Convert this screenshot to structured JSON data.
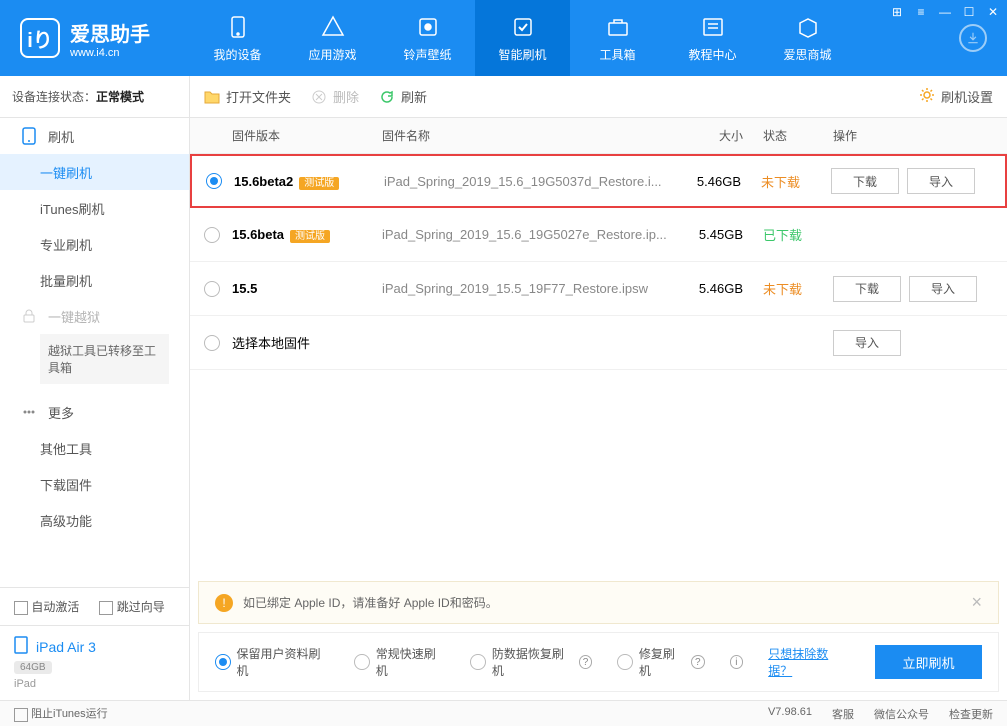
{
  "app": {
    "title": "爱思助手",
    "subtitle": "www.i4.cn"
  },
  "nav": {
    "tabs": [
      "我的设备",
      "应用游戏",
      "铃声壁纸",
      "智能刷机",
      "工具箱",
      "教程中心",
      "爱思商城"
    ],
    "active": 3
  },
  "deviceStatus": {
    "label": "设备连接状态：",
    "value": "正常模式"
  },
  "sidebar": {
    "flash_group": "刷机",
    "items": [
      "一键刷机",
      "iTunes刷机",
      "专业刷机",
      "批量刷机"
    ],
    "active": 0,
    "jailbreak": "一键越狱",
    "jailbreak_note": "越狱工具已转移至工具箱",
    "more_group": "更多",
    "more_items": [
      "其他工具",
      "下载固件",
      "高级功能"
    ]
  },
  "checks": {
    "auto_activate": "自动激活",
    "skip_guide": "跳过向导"
  },
  "device": {
    "name": "iPad Air 3",
    "storage": "64GB",
    "type": "iPad"
  },
  "toolbar": {
    "open_folder": "打开文件夹",
    "delete": "删除",
    "refresh": "刷新",
    "settings": "刷机设置"
  },
  "table": {
    "version": "固件版本",
    "name": "固件名称",
    "size": "大小",
    "status": "状态",
    "action": "操作"
  },
  "beta_badge": "测试版",
  "rows": [
    {
      "version": "15.6beta2",
      "beta": true,
      "name": "iPad_Spring_2019_15.6_19G5037d_Restore.i...",
      "size": "5.46GB",
      "status": "未下载",
      "status_cls": "notdl",
      "selected": true,
      "highlighted": true,
      "actions": true
    },
    {
      "version": "15.6beta",
      "beta": true,
      "name": "iPad_Spring_2019_15.6_19G5027e_Restore.ip...",
      "size": "5.45GB",
      "status": "已下载",
      "status_cls": "dl",
      "selected": false,
      "highlighted": false,
      "actions": false
    },
    {
      "version": "15.5",
      "beta": false,
      "name": "iPad_Spring_2019_15.5_19F77_Restore.ipsw",
      "size": "5.46GB",
      "status": "未下载",
      "status_cls": "notdl",
      "selected": false,
      "highlighted": false,
      "actions": true
    }
  ],
  "local_row": "选择本地固件",
  "actions": {
    "download": "下载",
    "import": "导入"
  },
  "notice": "如已绑定 Apple ID，请准备好 Apple ID和密码。",
  "options": {
    "opts": [
      "保留用户资料刷机",
      "常规快速刷机",
      "防数据恢复刷机",
      "修复刷机"
    ],
    "selected": 0,
    "erase_link": "只想抹除数据？",
    "flash_btn": "立即刷机"
  },
  "statusbar": {
    "stop_itunes": "阻止iTunes运行",
    "version": "V7.98.61",
    "support": "客服",
    "wechat": "微信公众号",
    "update": "检查更新"
  }
}
